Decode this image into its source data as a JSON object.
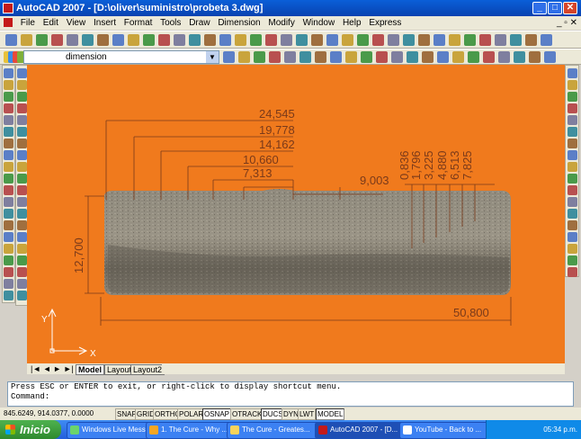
{
  "window": {
    "title": "AutoCAD 2007 - [D:\\oliver\\suministro\\probeta 3.dwg]",
    "controls": [
      "_",
      "□",
      "✕"
    ],
    "mdi_controls": "_ ▫ ✕"
  },
  "menu": [
    "File",
    "Edit",
    "View",
    "Insert",
    "Format",
    "Tools",
    "Draw",
    "Dimension",
    "Modify",
    "Window",
    "Help",
    "Express"
  ],
  "layers": {
    "current": "dimension"
  },
  "dimensions": {
    "horizontal": [
      "24,545",
      "19,778",
      "14,162",
      "10,660",
      "7,313",
      "9,003",
      "50,800"
    ],
    "vertical_right": [
      "0,836",
      "1,796",
      "3,225",
      "4,880",
      "6,513",
      "7,825"
    ],
    "vertical_left": "12,700"
  },
  "ucs": {
    "x": "X",
    "y": "Y"
  },
  "tabs": [
    "Model",
    "Layout1",
    "Layout2"
  ],
  "command": {
    "line1": "Press ESC or ENTER to exit, or right-click to display shortcut menu.",
    "prompt": "Command:"
  },
  "status": {
    "coords": "845.6249, 914.0377, 0.0000",
    "toggles": [
      "SNAP",
      "GRID",
      "ORTHO",
      "POLAR",
      "OSNAP",
      "OTRACK",
      "DUCS",
      "DYN",
      "LWT",
      "MODEL"
    ]
  },
  "taskbar": {
    "start": "Inicio",
    "tasks": [
      "Windows Live Mess...",
      "1. The Cure - Why ...",
      "The Cure - Greates...",
      "AutoCAD 2007 - [D...",
      "YouTube - Back to ..."
    ],
    "clock": "05:34 p.m."
  },
  "colors": {
    "drawing_bg": "#f07a1d",
    "dim_line": "#7a3a1a",
    "titlebar": "#0a5fd8",
    "taskbar": "#245edc"
  }
}
